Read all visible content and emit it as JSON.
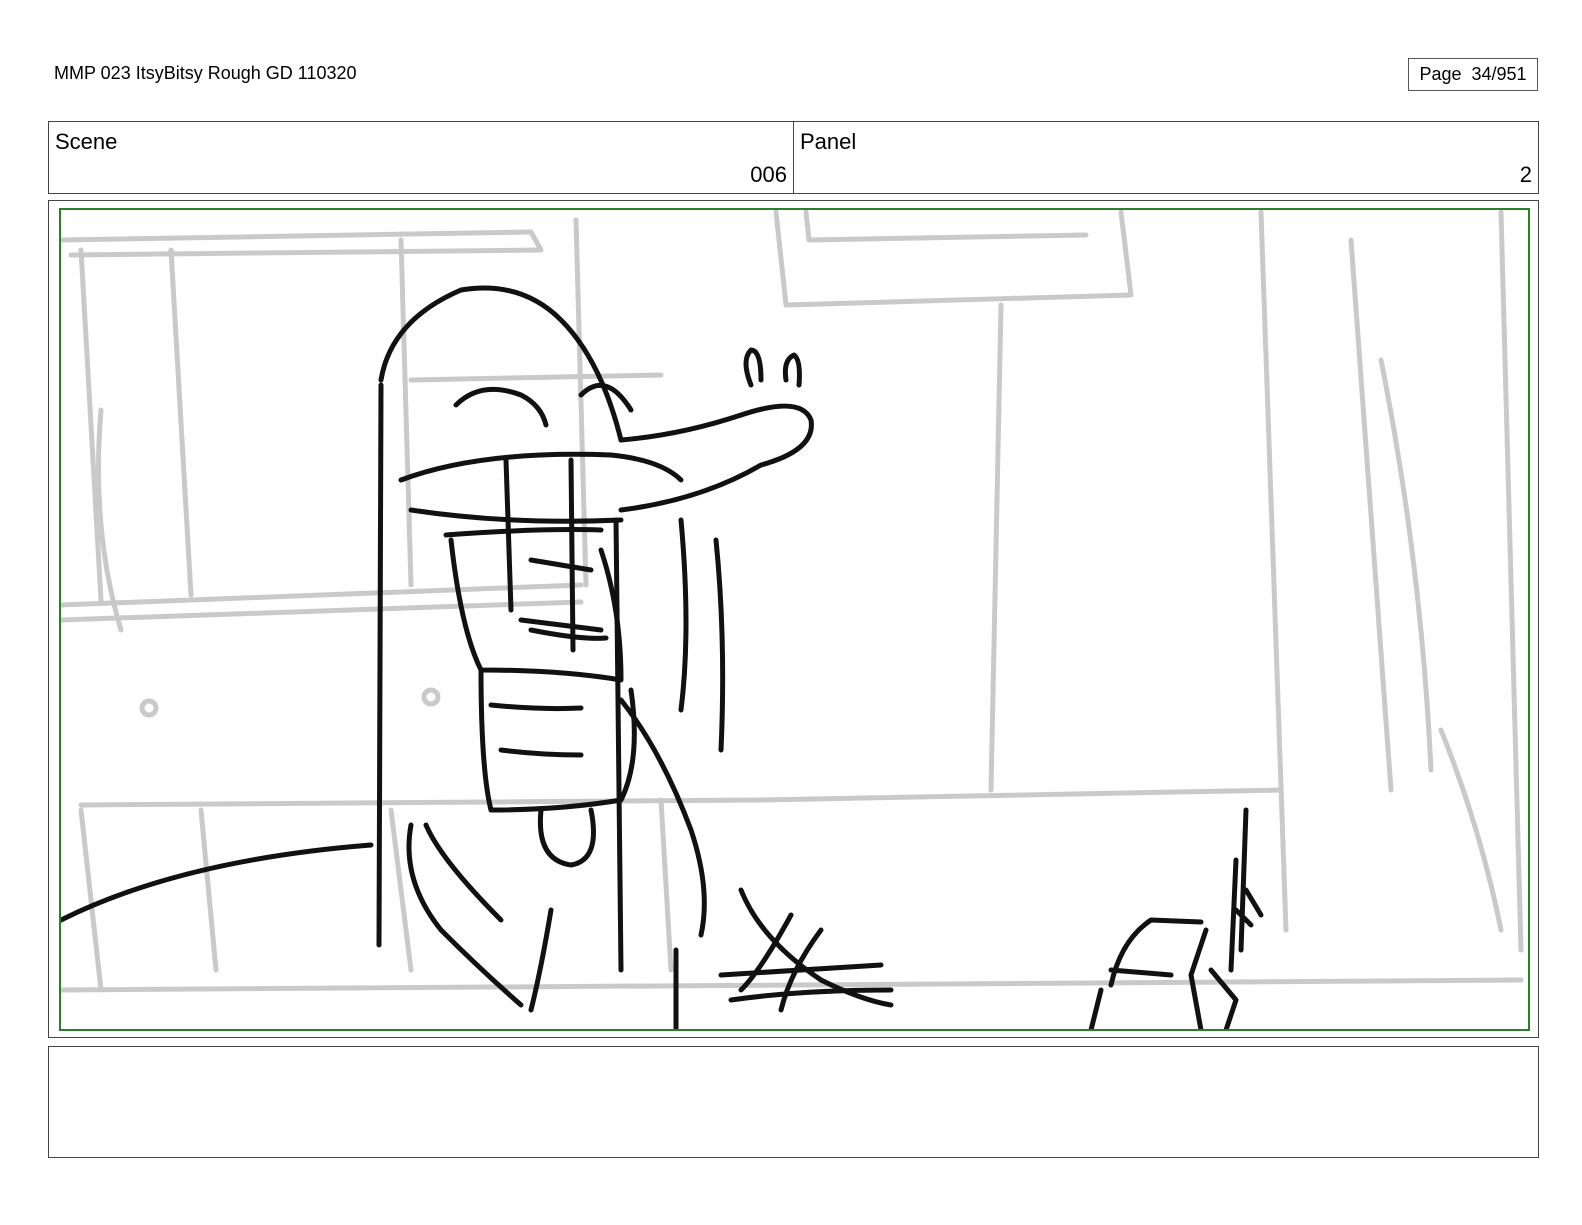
{
  "header": {
    "title": "MMP 023 ItsyBitsy Rough GD 110320",
    "page_label": "Page",
    "page_number": "34/951"
  },
  "scene": {
    "label": "Scene",
    "value": "006"
  },
  "panel": {
    "label": "Panel",
    "value": "2"
  },
  "colors": {
    "safe_frame": "#2e7d2e",
    "rough_background": "#c9c9c9",
    "rough_character": "#111111"
  },
  "notes": {
    "text": ""
  }
}
